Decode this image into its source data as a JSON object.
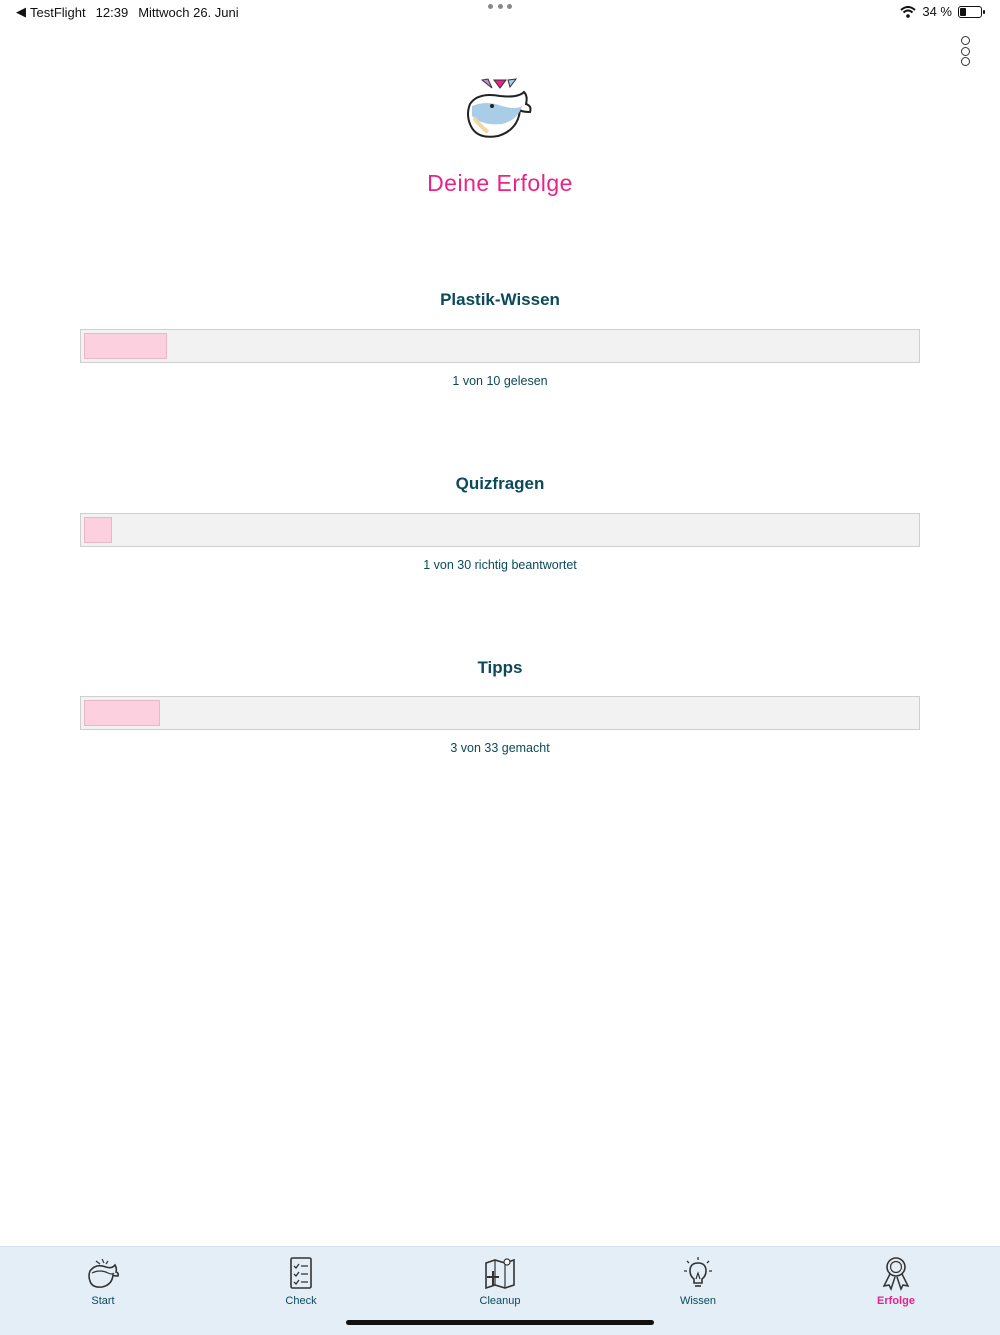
{
  "statusbar": {
    "back_app": "TestFlight",
    "time": "12:39",
    "date": "Mittwoch 26. Juni",
    "battery_percent": "34 %",
    "battery_level": 0.34
  },
  "header": {
    "title": "Deine Erfolge",
    "logo_icon": "whale-logo-icon",
    "menu_icon": "more-vertical-icon"
  },
  "sections": [
    {
      "title": "Plastik-Wissen",
      "caption": "1 von 10 gelesen",
      "progress": 0.1
    },
    {
      "title": "Quizfragen",
      "caption": "1 von 30 richtig beantwortet",
      "progress": 0.0333
    },
    {
      "title": "Tipps",
      "caption": "3 von 33 gemacht",
      "progress": 0.0909
    }
  ],
  "tabs": [
    {
      "label": "Start",
      "icon": "whale-icon"
    },
    {
      "label": "Check",
      "icon": "checklist-icon"
    },
    {
      "label": "Cleanup",
      "icon": "map-icon"
    },
    {
      "label": "Wissen",
      "icon": "lightbulb-icon"
    },
    {
      "label": "Erfolge",
      "icon": "award-icon",
      "active": true
    }
  ],
  "colors": {
    "accent": "#e8238a",
    "text": "#0b4a5a",
    "progress_fill": "#fdd0e0",
    "progress_track": "#f2f2f2",
    "tabbar_bg": "#e3eef7"
  }
}
